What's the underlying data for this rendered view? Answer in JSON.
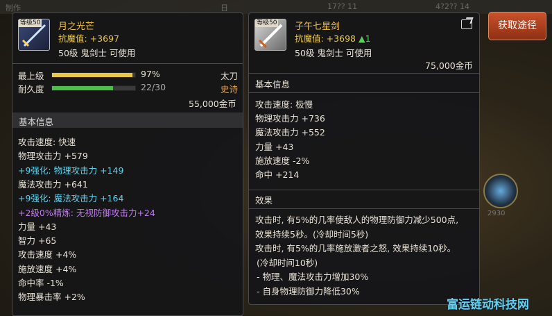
{
  "background": {
    "topbar": [
      "制作",
      "日",
      "17?? 11",
      "4?2?? 14"
    ],
    "badge_num": "2930"
  },
  "left": {
    "level_tag": "等级50",
    "name": "月之光芒",
    "resist": "抗魔值: +3697",
    "req": "50级 鬼剑士 可使用",
    "upgrade_label": "最上级",
    "upgrade_pct": "97%",
    "upgrade_value": 0.97,
    "type": "太刀",
    "dura_label": "耐久度",
    "dura_val": "22/30",
    "dura_value": 0.733,
    "rarity": "史诗",
    "price": "55,000金币",
    "section": "基本信息",
    "stats": [
      {
        "text": "攻击速度: 快速",
        "style": "normal"
      },
      {
        "text": "物理攻击力 +579",
        "style": "normal"
      },
      {
        "text": "+9强化: 物理攻击力 +149",
        "style": "cyan"
      },
      {
        "text": "魔法攻击力 +641",
        "style": "normal"
      },
      {
        "text": "+9强化: 魔法攻击力 +164",
        "style": "cyan"
      },
      {
        "text": "+2级0%精炼: 无视防御攻击力+24",
        "style": "purple"
      },
      {
        "text": "力量 +43",
        "style": "normal"
      },
      {
        "text": "智力 +65",
        "style": "normal"
      },
      {
        "text": "攻击速度 +4%",
        "style": "normal"
      },
      {
        "text": "施放速度 +4%",
        "style": "normal"
      },
      {
        "text": "命中率 -1%",
        "style": "normal"
      },
      {
        "text": "物理暴击率 +2%",
        "style": "normal"
      }
    ]
  },
  "right": {
    "level_tag": "等级50",
    "name": "子午七星剑",
    "resist": "抗魔值: +3698",
    "resist_up": "▲1",
    "req": "50级 鬼剑士 可使用",
    "price": "75,000金币",
    "section_basic": "基本信息",
    "stats": [
      "攻击速度: 极慢",
      "物理攻击力 +736",
      "魔法攻击力 +552",
      "力量 +43",
      "施放速度 -2%",
      "命中 +214"
    ],
    "section_effect": "效果",
    "effects": [
      "攻击时, 有5%的几率使敌人的物理防御力减少500点,",
      "效果持续5秒。(冷却时间5秒)",
      "攻击时, 有5%的几率施放激者之怒, 效果持续10秒。",
      "(冷却时间10秒)",
      "- 物理、魔法攻击力增加30%",
      "- 自身物理防御力降低30%"
    ]
  },
  "acquire_button": "获取途径",
  "watermark": "富运链动科技网"
}
